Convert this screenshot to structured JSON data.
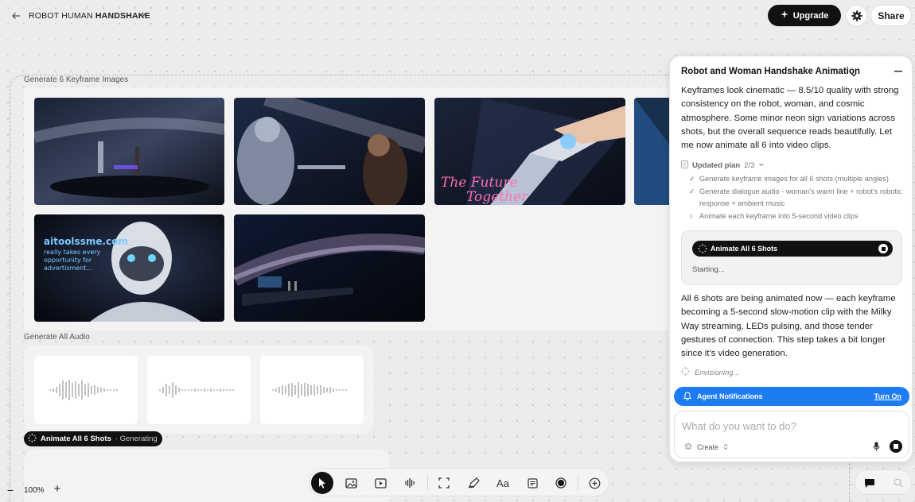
{
  "header": {
    "project_title_prefix": "ROBOT HUMAN",
    "project_title_bold": "HANDSHAKE",
    "upgrade_label": "Upgrade",
    "share_label": "Share"
  },
  "canvas": {
    "images_section_label": "Generate 6 Keyframe Images",
    "audio_section_label": "Generate All Audio",
    "image_overlay_texts": {
      "future_sign": "The Future Together",
      "ad_sign": "aitoolssme.com really takes every opportunity for advertisment..."
    },
    "status_chip": {
      "title": "Animate All 6 Shots",
      "state": " · Generating"
    }
  },
  "zoom": {
    "minus": "−",
    "level": "100%",
    "plus": "+"
  },
  "toolbar": {
    "tools": [
      "select-tool",
      "image-tool",
      "video-tool",
      "audio-tool",
      "frame-tool",
      "draw-tool",
      "text-tool",
      "notes-tool",
      "record-tool",
      "add-tool"
    ],
    "text_tool_label": "Aa"
  },
  "agent": {
    "title": "Robot and Woman Handshake Animation",
    "message_1": "Keyframes look cinematic — 8.5/10 quality with strong consistency on the robot, woman, and cosmic atmosphere. Some minor neon sign variations across shots, but the overall sequence reads beautifully. Let me now animate all 6 into video clips.",
    "plan_label": "Updated plan",
    "plan_progress": "2/3",
    "plan_items": [
      {
        "mark": "✓",
        "text": "Generate keyframe images for all 6 shots (multiple angles)"
      },
      {
        "mark": "✓",
        "text": "Generate dialogue audio - woman's warm line + robot's robotic response + ambient music"
      },
      {
        "mark": "○",
        "text": "Animate each keyframe into 5-second video clips"
      }
    ],
    "task_title": "Animate All 6 Shots",
    "task_status": "Starting...",
    "message_2": "All 6 shots are being animated now — each keyframe becoming a 5-second slow-motion clip with the Milky Way streaming, LEDs pulsing, and those tender gestures of connection. This step takes a bit longer since it's video generation.",
    "envisioning": "Envisioning...",
    "notifications_label": "Agent Notifications",
    "notifications_action": "Turn On",
    "input_placeholder": "What do you want to do?",
    "create_label": "Create"
  },
  "colors": {
    "accent_blue": "#1d7cf2",
    "dark": "#111111",
    "canvas_bg": "#ececec"
  }
}
